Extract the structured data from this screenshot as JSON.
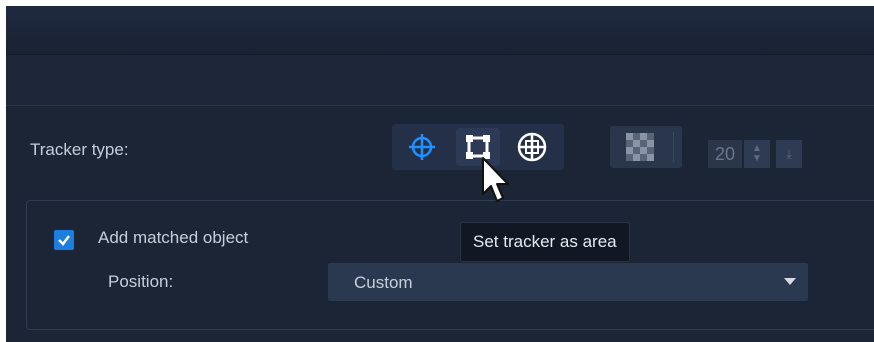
{
  "tracker": {
    "label": "Tracker type:",
    "buttons": [
      {
        "name": "point-tracker",
        "icon": "crosshair-icon",
        "color": "#1e90ff"
      },
      {
        "name": "area-tracker",
        "icon": "area-square-icon",
        "color": "#ffffff",
        "hovered": true
      },
      {
        "name": "globe-tracker",
        "icon": "globe-target-icon",
        "color": "#ffffff"
      }
    ],
    "grid_icon": "checkerboard-icon",
    "spin_value": "20"
  },
  "tooltip": {
    "text": "Set tracker as area"
  },
  "matched": {
    "checkbox_checked": true,
    "label": "Add matched object",
    "position_label": "Position:",
    "position_value": "Custom"
  },
  "colors": {
    "background": "#1b2535",
    "accent": "#1e90ff",
    "text": "#c7cedb"
  }
}
